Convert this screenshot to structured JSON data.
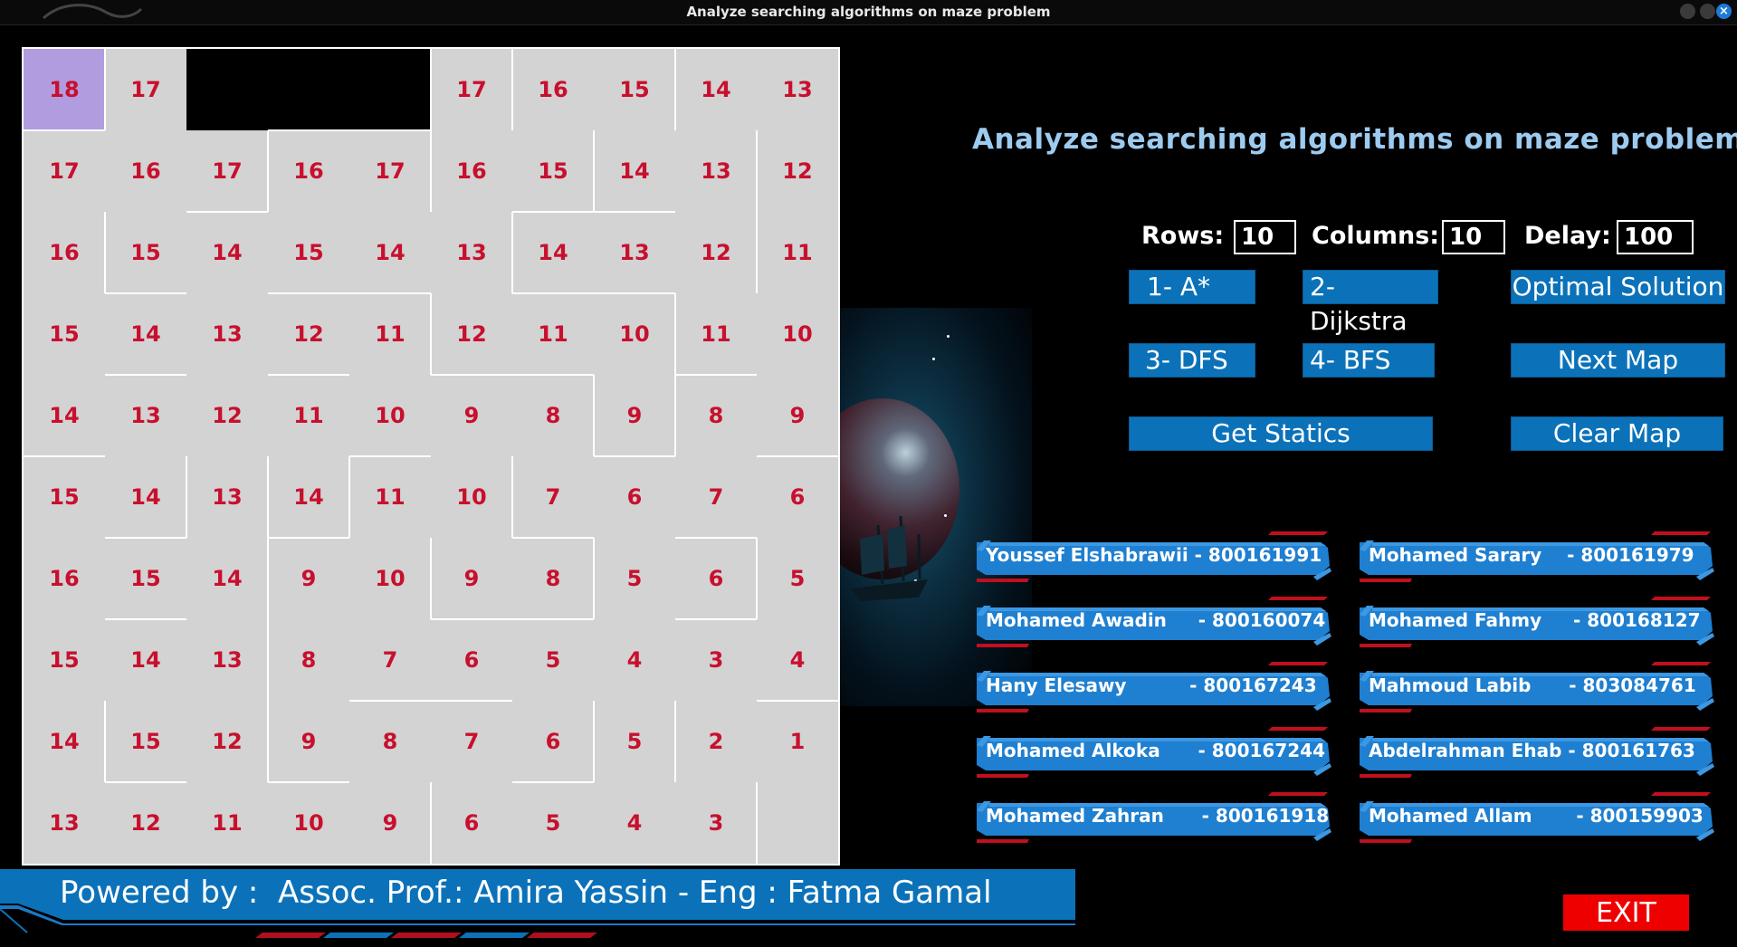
{
  "window": {
    "title": "Analyze searching algorithms on maze problem",
    "close_glyph": "×"
  },
  "heading": "Analyze searching algorithms on maze problem",
  "inputs": {
    "rows_label": "Rows:",
    "rows_value": "10",
    "columns_label": "Columns:",
    "columns_value": "10",
    "delay_label": "Delay:",
    "delay_value": "100"
  },
  "buttons": {
    "astar": "1- A*",
    "dijkstra": "2- Dijkstra",
    "optimal": "Optimal Solution",
    "dfs": "3- DFS",
    "bfs": "4- BFS",
    "next_map": "Next Map",
    "statics": "Get Statics",
    "clear_map": "Clear Map",
    "exit": "EXIT"
  },
  "maze": {
    "rows": 10,
    "cols": 10,
    "start": [
      0,
      0
    ],
    "colors": {
      "cell": "#d3d3d3",
      "start": "#b19ce0",
      "blocked": "#000000",
      "number": "#c8102e",
      "wall": "#ffffff"
    },
    "grid": [
      [
        "18",
        "17",
        null,
        null,
        null,
        "17",
        "16",
        "15",
        "14",
        "13"
      ],
      [
        "17",
        "16",
        "17",
        "16",
        "17",
        "16",
        "15",
        "14",
        "13",
        "12"
      ],
      [
        "16",
        "15",
        "14",
        "15",
        "14",
        "13",
        "14",
        "13",
        "12",
        "11"
      ],
      [
        "15",
        "14",
        "13",
        "12",
        "11",
        "12",
        "11",
        "10",
        "11",
        "10"
      ],
      [
        "14",
        "13",
        "12",
        "11",
        "10",
        "9",
        "8",
        "9",
        "8",
        "9"
      ],
      [
        "15",
        "14",
        "13",
        "14",
        "11",
        "10",
        "7",
        "6",
        "7",
        "6"
      ],
      [
        "16",
        "15",
        "14",
        "9",
        "10",
        "9",
        "8",
        "5",
        "6",
        "5"
      ],
      [
        "15",
        "14",
        "13",
        "8",
        "7",
        "6",
        "5",
        "4",
        "3",
        "4"
      ],
      [
        "14",
        "15",
        "12",
        "9",
        "8",
        "7",
        "6",
        "5",
        "2",
        "1"
      ],
      [
        "13",
        "12",
        "11",
        "10",
        "9",
        "6",
        "5",
        "4",
        "3",
        ""
      ]
    ],
    "blocked": [
      [
        0,
        2
      ],
      [
        0,
        3
      ],
      [
        0,
        4
      ]
    ]
  },
  "team": [
    {
      "name": "Youssef Elshabrawii",
      "id": "800161991"
    },
    {
      "name": "Mohamed Sarary",
      "id": "800161979"
    },
    {
      "name": "Mohamed Awadin",
      "id": "800160074"
    },
    {
      "name": "Mohamed Fahmy",
      "id": "800168127"
    },
    {
      "name": "Hany Elesawy",
      "id": "800167243"
    },
    {
      "name": "Mahmoud Labib",
      "id": "803084761"
    },
    {
      "name": "Mohamed Alkoka",
      "id": "800167244"
    },
    {
      "name": "Abdelrahman Ehab",
      "id": "800161763"
    },
    {
      "name": "Mohamed Zahran",
      "id": "800161918"
    },
    {
      "name": "Mohamed Allam",
      "id": "800159903"
    }
  ],
  "team_lines": [
    "Youssef Elshabrawii - 800161991",
    "Mohamed Sarary    - 800161979",
    "Mohamed Awadin     - 800160074",
    "Mohamed Fahmy     - 800168127",
    "Hany Elesawy          - 800167243",
    "Mahmoud Labib      - 803084761",
    "Mohamed Alkoka      - 800167244",
    "Abdelrahman Ehab - 800161763",
    "Mohamed Zahran      - 800161918",
    "Mohamed Allam       - 800159903"
  ],
  "footer": "Powered by :  Assoc. Prof.: Amira Yassin - Eng : Fatma Gamal",
  "theme": {
    "accent": "#0b72b9",
    "heading": "#9dcbf0",
    "exit": "#ee0000",
    "plate_red": "#c0101e"
  }
}
